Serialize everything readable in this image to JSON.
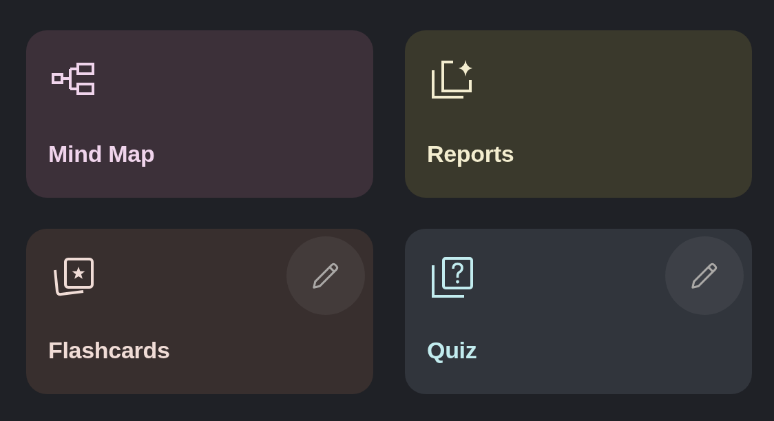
{
  "cards": [
    {
      "kind": "mind_map",
      "label": "Mind Map",
      "color": "#3c3039",
      "editable": false
    },
    {
      "kind": "reports",
      "label": "Reports",
      "color": "#3a392c",
      "editable": false
    },
    {
      "kind": "flashcards",
      "label": "Flashcards",
      "color": "#382f2e",
      "editable": true
    },
    {
      "kind": "quiz",
      "label": "Quiz",
      "color": "#31353c",
      "editable": true
    }
  ]
}
